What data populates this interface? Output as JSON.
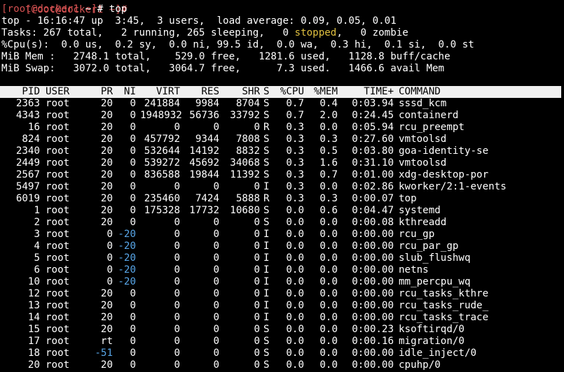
{
  "prompt_prev": "[root@docker1 ~]#",
  "prompt": {
    "open": "[",
    "user_host": "root@docker1",
    "path": " ~",
    "close": "]",
    "symbol": "# ",
    "command": "top"
  },
  "summary": {
    "line1": "top - 16:16:47 up  3:45,  3 users,  load average: 0.09, 0.05, 0.01",
    "tasks_pre": "Tasks: 267 total,   2 running, 265 sleeping,   0 ",
    "tasks_stopped": "stopped",
    "tasks_post": ",   0 zombie",
    "cpu": "%Cpu(s):  0.0 us,  0.2 sy,  0.0 ni, 99.5 id,  0.0 wa,  0.3 hi,  0.1 si,  0.0 st",
    "mem": "MiB Mem :   2748.1 total,    529.0 free,   1281.6 used,   1128.8 buff/cache",
    "swap": "MiB Swap:   3072.0 total,   3064.7 free,      7.3 used.   1466.6 avail Mem"
  },
  "columns": [
    "PID",
    "USER",
    "PR",
    "NI",
    "VIRT",
    "RES",
    "SHR",
    "S",
    "%CPU",
    "%MEM",
    "TIME+",
    "COMMAND"
  ],
  "processes": [
    [
      "2363",
      "root",
      "20",
      "0",
      "241884",
      "9984",
      "8704",
      "S",
      "0.7",
      "0.4",
      "0:03.94",
      "sssd_kcm"
    ],
    [
      "4343",
      "root",
      "20",
      "0",
      "1948932",
      "56736",
      "33792",
      "S",
      "0.7",
      "2.0",
      "0:24.45",
      "containerd"
    ],
    [
      "16",
      "root",
      "20",
      "0",
      "0",
      "0",
      "0",
      "R",
      "0.3",
      "0.0",
      "0:05.94",
      "rcu_preempt"
    ],
    [
      "824",
      "root",
      "20",
      "0",
      "457792",
      "9344",
      "7808",
      "S",
      "0.3",
      "0.3",
      "0:27.60",
      "vmtoolsd"
    ],
    [
      "2340",
      "root",
      "20",
      "0",
      "532644",
      "14192",
      "8832",
      "S",
      "0.3",
      "0.5",
      "0:03.80",
      "goa-identity-se"
    ],
    [
      "2449",
      "root",
      "20",
      "0",
      "539272",
      "45692",
      "34068",
      "S",
      "0.3",
      "1.6",
      "0:31.10",
      "vmtoolsd"
    ],
    [
      "2567",
      "root",
      "20",
      "0",
      "836588",
      "19844",
      "11392",
      "S",
      "0.3",
      "0.7",
      "0:01.00",
      "xdg-desktop-por"
    ],
    [
      "5497",
      "root",
      "20",
      "0",
      "0",
      "0",
      "0",
      "I",
      "0.3",
      "0.0",
      "0:02.86",
      "kworker/2:1-events"
    ],
    [
      "6019",
      "root",
      "20",
      "0",
      "235460",
      "7424",
      "5888",
      "R",
      "0.3",
      "0.3",
      "0:00.07",
      "top"
    ],
    [
      "1",
      "root",
      "20",
      "0",
      "175328",
      "17732",
      "10680",
      "S",
      "0.0",
      "0.6",
      "0:04.47",
      "systemd"
    ],
    [
      "2",
      "root",
      "20",
      "0",
      "0",
      "0",
      "0",
      "S",
      "0.0",
      "0.0",
      "0:00.08",
      "kthreadd"
    ],
    [
      "3",
      "root",
      "0",
      "-20",
      "0",
      "0",
      "0",
      "I",
      "0.0",
      "0.0",
      "0:00.00",
      "rcu_gp"
    ],
    [
      "4",
      "root",
      "0",
      "-20",
      "0",
      "0",
      "0",
      "I",
      "0.0",
      "0.0",
      "0:00.00",
      "rcu_par_gp"
    ],
    [
      "5",
      "root",
      "0",
      "-20",
      "0",
      "0",
      "0",
      "I",
      "0.0",
      "0.0",
      "0:00.00",
      "slub_flushwq"
    ],
    [
      "6",
      "root",
      "0",
      "-20",
      "0",
      "0",
      "0",
      "I",
      "0.0",
      "0.0",
      "0:00.00",
      "netns"
    ],
    [
      "10",
      "root",
      "0",
      "-20",
      "0",
      "0",
      "0",
      "I",
      "0.0",
      "0.0",
      "0:00.00",
      "mm_percpu_wq"
    ],
    [
      "12",
      "root",
      "20",
      "0",
      "0",
      "0",
      "0",
      "I",
      "0.0",
      "0.0",
      "0:00.00",
      "rcu_tasks_kthre"
    ],
    [
      "13",
      "root",
      "20",
      "0",
      "0",
      "0",
      "0",
      "I",
      "0.0",
      "0.0",
      "0:00.00",
      "rcu_tasks_rude_"
    ],
    [
      "14",
      "root",
      "20",
      "0",
      "0",
      "0",
      "0",
      "I",
      "0.0",
      "0.0",
      "0:00.00",
      "rcu_tasks_trace"
    ],
    [
      "15",
      "root",
      "20",
      "0",
      "0",
      "0",
      "0",
      "S",
      "0.0",
      "0.0",
      "0:00.23",
      "ksoftirqd/0"
    ],
    [
      "17",
      "root",
      "rt",
      "0",
      "0",
      "0",
      "0",
      "S",
      "0.0",
      "0.0",
      "0:00.16",
      "migration/0"
    ],
    [
      "18",
      "root",
      "-51",
      "0",
      "0",
      "0",
      "0",
      "S",
      "0.0",
      "0.0",
      "0:00.00",
      "idle_inject/0"
    ],
    [
      "20",
      "root",
      "20",
      "0",
      "0",
      "0",
      "0",
      "S",
      "0.0",
      "0.0",
      "0:00.00",
      "cpuhp/0"
    ]
  ],
  "colors": {
    "prompt": "#d25050",
    "stopped": "#e0c040",
    "negative": "#58a6e8",
    "header_bg": "#f0f0f0"
  }
}
